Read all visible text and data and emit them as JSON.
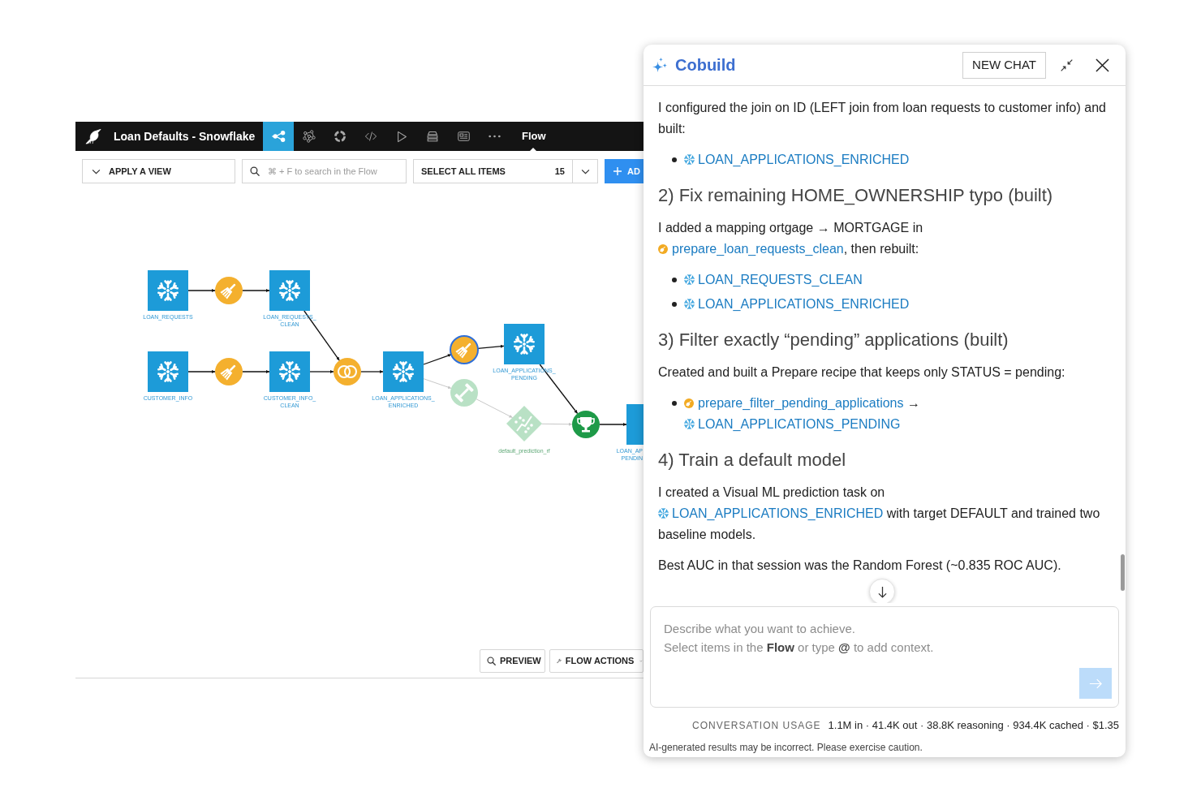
{
  "flow_window": {
    "title": "Loan Defaults - Snowflake",
    "nav_tabs": [
      {
        "kind": "nodes",
        "selected": true
      },
      {
        "kind": "network",
        "selected": false
      },
      {
        "kind": "ring",
        "selected": false
      },
      {
        "kind": "code",
        "selected": false
      },
      {
        "kind": "play",
        "selected": false
      },
      {
        "kind": "stack",
        "selected": false
      },
      {
        "kind": "card",
        "selected": false
      },
      {
        "kind": "dots",
        "selected": false
      }
    ],
    "section": "Flow",
    "toolbar": {
      "view_dropdown": "APPLY A VIEW",
      "search": {
        "placeholder": "⌘ + F to search in the Flow"
      },
      "select_all": {
        "label": "SELECT ALL ITEMS",
        "count": "15"
      },
      "add_button": "AD"
    },
    "nodes": [
      {
        "kind": "dataset",
        "label": [
          "LOAN_REQUESTS"
        ],
        "selected": false,
        "dimmed": false
      },
      {
        "kind": "prepare",
        "selected": false,
        "dimmed": false
      },
      {
        "kind": "dataset",
        "label": [
          "LOAN_REQUESTS_",
          "CLEAN"
        ],
        "selected": false,
        "dimmed": false
      },
      {
        "kind": "dataset",
        "label": [
          "CUSTOMER_INFO"
        ],
        "selected": false,
        "dimmed": false
      },
      {
        "kind": "prepare",
        "selected": false,
        "dimmed": false
      },
      {
        "kind": "dataset",
        "label": [
          "CUSTOMER_INFO_",
          "CLEAN"
        ],
        "selected": false,
        "dimmed": false
      },
      {
        "kind": "join",
        "selected": false,
        "dimmed": false
      },
      {
        "kind": "dataset",
        "label": [
          "LOAN_APPLICATIONS_",
          "ENRICHED"
        ],
        "selected": false,
        "dimmed": false
      },
      {
        "kind": "prepare",
        "selected": true,
        "dimmed": false
      },
      {
        "kind": "dataset",
        "label": [
          "LOAN_APPLICATIONS_",
          "PENDING"
        ],
        "selected": false,
        "dimmed": false
      },
      {
        "kind": "train",
        "selected": false,
        "dimmed": true
      },
      {
        "kind": "model",
        "label": [
          "default_prediction_rf"
        ],
        "selected": false,
        "dimmed": true
      },
      {
        "kind": "score",
        "selected": false,
        "dimmed": false
      },
      {
        "kind": "dataset",
        "label": [
          "LOAN_AP",
          "PENDIN"
        ],
        "selected": false,
        "dimmed": false
      }
    ],
    "bottom_buttons": [
      {
        "kind": "search",
        "label": "PREVIEW"
      },
      {
        "kind": "wrench",
        "label": "FLOW ACTIONS",
        "menu": true
      }
    ]
  },
  "assistant_panel": {
    "title": "Cobuild",
    "new_chat_button": "NEW CHAT",
    "messages": [
      {
        "kind": "paragraph",
        "parts": [
          {
            "kind": "text",
            "text": "I configured the join on ID (LEFT join from loan requests to customer info) and built:"
          }
        ]
      },
      {
        "kind": "bullets",
        "items": [
          {
            "parts": [
              {
                "kind": "dataset_link",
                "text": "LOAN_APPLICATIONS_ENRICHED"
              }
            ]
          }
        ]
      },
      {
        "kind": "heading",
        "text": "2) Fix remaining HOME_OWNERSHIP typo (built)"
      },
      {
        "kind": "paragraph",
        "parts": [
          {
            "kind": "text",
            "text": "I added a mapping ortgage → MORTGAGE in "
          },
          {
            "kind": "recipe_link",
            "text": "prepare_loan_requests_clean"
          },
          {
            "kind": "text",
            "text": ", then rebuilt:"
          }
        ]
      },
      {
        "kind": "bullets",
        "items": [
          {
            "parts": [
              {
                "kind": "dataset_link",
                "text": "LOAN_REQUESTS_CLEAN"
              }
            ]
          },
          {
            "parts": [
              {
                "kind": "dataset_link",
                "text": "LOAN_APPLICATIONS_ENRICHED"
              }
            ]
          }
        ]
      },
      {
        "kind": "heading",
        "text": "3) Filter exactly “pending” applications (built)"
      },
      {
        "kind": "paragraph",
        "parts": [
          {
            "kind": "text",
            "text": "Created and built a Prepare recipe that keeps only STATUS = pending:"
          }
        ]
      },
      {
        "kind": "bullets",
        "items": [
          {
            "parts": [
              {
                "kind": "recipe_link",
                "text": "prepare_filter_pending_applications"
              },
              {
                "kind": "text",
                "text": " → "
              },
              {
                "kind": "dataset_link",
                "text": "LOAN_APPLICATIONS_PENDING"
              }
            ]
          }
        ]
      },
      {
        "kind": "heading",
        "text": "4) Train a default model"
      },
      {
        "kind": "paragraph",
        "parts": [
          {
            "kind": "text",
            "text": "I created a Visual ML prediction task on "
          },
          {
            "kind": "dataset_link",
            "text": "LOAN_APPLICATIONS_ENRICHED"
          },
          {
            "kind": "text",
            "text": " with target DEFAULT and trained two baseline models."
          }
        ]
      },
      {
        "kind": "paragraph",
        "parts": [
          {
            "kind": "text",
            "text": "Best AUC in that session was the Random Forest (~0.835 ROC AUC)."
          }
        ]
      }
    ],
    "composer": {
      "placeholder": [
        "Describe what you want to achieve.",
        "Select items in the **Flow** or type **@** to add context."
      ],
      "send_button": {
        "disabled": true
      }
    },
    "usage": {
      "label": "CONVERSATION USAGE",
      "value": "1.1M in · 41.4K out · 38.8K reasoning · 934.4K cached · $1.35"
    },
    "disclaimer": "AI-generated results may be incorrect. Please exercise caution."
  }
}
